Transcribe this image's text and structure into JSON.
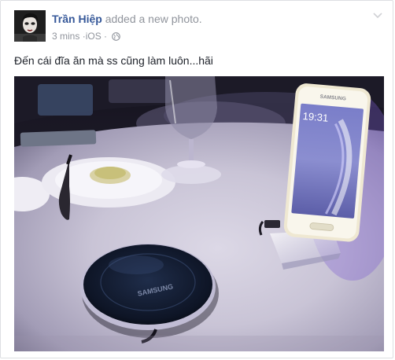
{
  "post": {
    "author": "Trần Hiệp",
    "action": "added a new photo.",
    "time": "3 mins",
    "separator": "·",
    "source": "iOS",
    "privacy_icon": "globe-icon",
    "text": "Đến cái đĩa ăn mà ss cũng làm luôn...hãi"
  },
  "photo": {
    "phone_brand": "SAMSUNG",
    "phone_clock": "19:31",
    "charger_brand": "SAMSUNG"
  },
  "colors": {
    "author_link": "#365899",
    "meta_gray": "#90949c",
    "body_text": "#1d2129"
  }
}
